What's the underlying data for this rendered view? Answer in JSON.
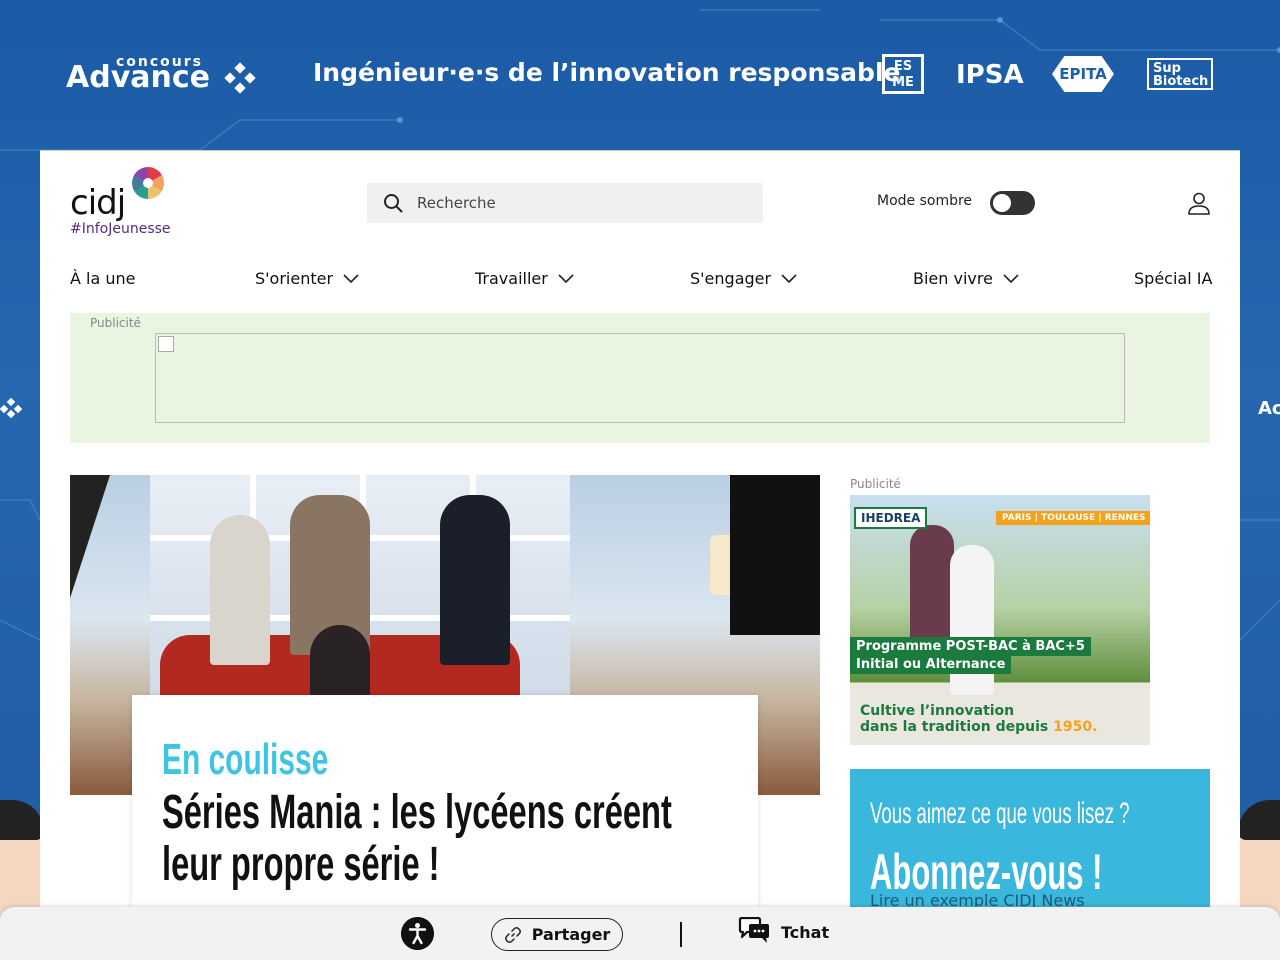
{
  "banner": {
    "brand_small": "concours",
    "brand_big": "Advance",
    "tagline": "Ingénieur·e·s de l’innovation responsable",
    "partners": {
      "esme": "ES ME",
      "ipsa": "IPSA",
      "epita": "EPITA",
      "supbiotech": "Sup Biotech"
    },
    "side_left": "",
    "side_right": "Ac"
  },
  "header": {
    "logo_text": "cidj",
    "logo_sub": "#InfoJeunesse",
    "search_placeholder": "Recherche",
    "dark_mode_label": "Mode sombre",
    "dark_mode_on": false
  },
  "nav": {
    "items": [
      {
        "label": "À la une",
        "has_menu": false
      },
      {
        "label": "S'orienter",
        "has_menu": true
      },
      {
        "label": "Travailler",
        "has_menu": true
      },
      {
        "label": "S'engager",
        "has_menu": true
      },
      {
        "label": "Bien vivre",
        "has_menu": true
      },
      {
        "label": "Spécial IA",
        "has_menu": false
      }
    ]
  },
  "ad_top": {
    "label": "Publicité"
  },
  "article": {
    "kicker": "En coulisse",
    "headline": "Séries Mania : les lycéens créent leur propre série !"
  },
  "side_ad": {
    "label": "Publicité",
    "brand": "IHEDREA",
    "cities": "PARIS | TOULOUSE | RENNES",
    "program_line1": "Programme POST-BAC à BAC+5",
    "program_line2": "Initial ou Alternance",
    "slogan_line1": "Cultive l’innovation",
    "slogan_line2_prefix": "dans la tradition depuis ",
    "slogan_year": "1950."
  },
  "subscribe": {
    "question": "Vous aimez ce que vous lisez ?",
    "cta": "Abonnez-vous !",
    "example_link": "Lire un exemple CIDJ News"
  },
  "bottom_bar": {
    "share_label": "Partager",
    "chat_label": "Tchat"
  },
  "colors": {
    "banner_blue": "#1f5fa8",
    "accent_cyan": "#3ec5e3",
    "subscribe_bg": "#3ab7dc",
    "ad_green_bg": "#e9f5e1",
    "purple": "#5b2a7e"
  }
}
